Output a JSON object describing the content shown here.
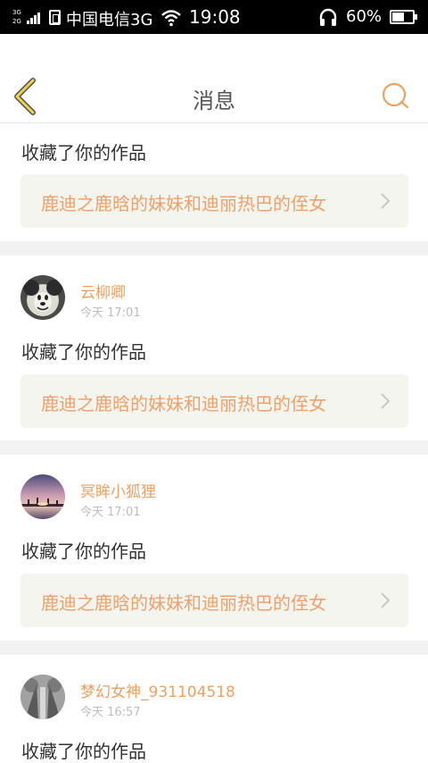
{
  "status_bar": {
    "network_top": "3G",
    "network_bottom": "2G",
    "carrier": "中国电信3G",
    "time": "19:08",
    "battery_percent": "60%",
    "battery_level": 0.6,
    "icons": [
      "signal-icon",
      "sim-icon",
      "wifi-icon",
      "headset-icon",
      "battery-icon"
    ]
  },
  "header": {
    "title": "消息",
    "back_icon": "chevron-left-icon",
    "search_icon": "search-icon",
    "accent_color": "#f0a060"
  },
  "feed": {
    "items": [
      {
        "action": "收藏了你的作品",
        "work_title": "鹿迪之鹿晗的妹妹和迪丽热巴的侄女"
      },
      {
        "username": "云柳卿",
        "time": "今天 17:01",
        "action": "收藏了你的作品",
        "work_title": "鹿迪之鹿晗的妹妹和迪丽热巴的侄女"
      },
      {
        "username": "冥眸小狐狸",
        "time": "今天 17:01",
        "action": "收藏了你的作品",
        "work_title": "鹿迪之鹿晗的妹妹和迪丽热巴的侄女"
      },
      {
        "username": "梦幻女神_931104518",
        "time": "今天 16:57",
        "action": "收藏了你的作品"
      }
    ]
  }
}
